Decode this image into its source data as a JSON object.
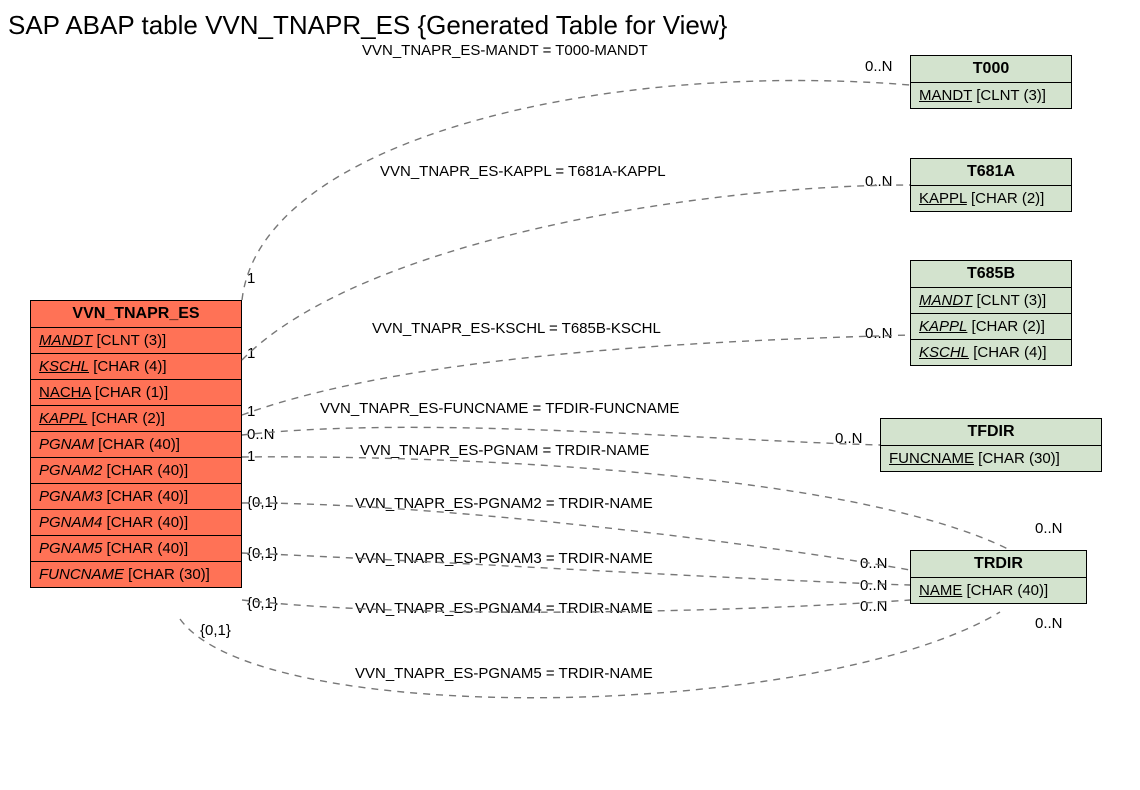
{
  "title": "SAP ABAP table VVN_TNAPR_ES {Generated Table for View}",
  "main": {
    "name": "VVN_TNAPR_ES",
    "fields": [
      {
        "name": "MANDT",
        "type": "[CLNT (3)]",
        "u": true,
        "i": true
      },
      {
        "name": "KSCHL",
        "type": "[CHAR (4)]",
        "u": true,
        "i": true
      },
      {
        "name": "NACHA",
        "type": "[CHAR (1)]",
        "u": true,
        "i": false
      },
      {
        "name": "KAPPL",
        "type": "[CHAR (2)]",
        "u": true,
        "i": true
      },
      {
        "name": "PGNAM",
        "type": "[CHAR (40)]",
        "u": false,
        "i": true
      },
      {
        "name": "PGNAM2",
        "type": "[CHAR (40)]",
        "u": false,
        "i": true
      },
      {
        "name": "PGNAM3",
        "type": "[CHAR (40)]",
        "u": false,
        "i": true
      },
      {
        "name": "PGNAM4",
        "type": "[CHAR (40)]",
        "u": false,
        "i": true
      },
      {
        "name": "PGNAM5",
        "type": "[CHAR (40)]",
        "u": false,
        "i": true
      },
      {
        "name": "FUNCNAME",
        "type": "[CHAR (30)]",
        "u": false,
        "i": true
      }
    ]
  },
  "refs": {
    "t000": {
      "name": "T000",
      "fields": [
        {
          "name": "MANDT",
          "type": "[CLNT (3)]",
          "u": true,
          "i": false
        }
      ]
    },
    "t681a": {
      "name": "T681A",
      "fields": [
        {
          "name": "KAPPL",
          "type": "[CHAR (2)]",
          "u": true,
          "i": false
        }
      ]
    },
    "t685b": {
      "name": "T685B",
      "fields": [
        {
          "name": "MANDT",
          "type": "[CLNT (3)]",
          "u": true,
          "i": true
        },
        {
          "name": "KAPPL",
          "type": "[CHAR (2)]",
          "u": true,
          "i": true
        },
        {
          "name": "KSCHL",
          "type": "[CHAR (4)]",
          "u": true,
          "i": true
        }
      ]
    },
    "tfdir": {
      "name": "TFDIR",
      "fields": [
        {
          "name": "FUNCNAME",
          "type": "[CHAR (30)]",
          "u": true,
          "i": false
        }
      ]
    },
    "trdir": {
      "name": "TRDIR",
      "fields": [
        {
          "name": "NAME",
          "type": "[CHAR (40)]",
          "u": true,
          "i": false
        }
      ]
    }
  },
  "rels": [
    {
      "label": "VVN_TNAPR_ES-MANDT = T000-MANDT",
      "leftCard": "1",
      "rightCard": "0..N"
    },
    {
      "label": "VVN_TNAPR_ES-KAPPL = T681A-KAPPL",
      "leftCard": "1",
      "rightCard": "0..N"
    },
    {
      "label": "VVN_TNAPR_ES-KSCHL = T685B-KSCHL",
      "leftCard": "1",
      "rightCard": "0..N"
    },
    {
      "label": "VVN_TNAPR_ES-FUNCNAME = TFDIR-FUNCNAME",
      "leftCard": "0..N",
      "rightCard": "0..N"
    },
    {
      "label": "VVN_TNAPR_ES-PGNAM = TRDIR-NAME",
      "leftCard": "1",
      "rightCard": "0..N"
    },
    {
      "label": "VVN_TNAPR_ES-PGNAM2 = TRDIR-NAME",
      "leftCard": "{0,1}",
      "rightCard": "0..N"
    },
    {
      "label": "VVN_TNAPR_ES-PGNAM3 = TRDIR-NAME",
      "leftCard": "{0,1}",
      "rightCard": "0..N"
    },
    {
      "label": "VVN_TNAPR_ES-PGNAM4 = TRDIR-NAME",
      "leftCard": "{0,1}",
      "rightCard": "0..N"
    },
    {
      "label": "VVN_TNAPR_ES-PGNAM5 = TRDIR-NAME",
      "leftCard": "{0,1}",
      "rightCard": "0..N"
    }
  ]
}
